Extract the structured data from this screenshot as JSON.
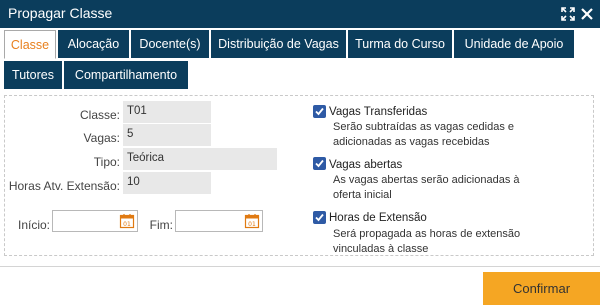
{
  "window": {
    "title": "Propagar Classe"
  },
  "tabs": [
    {
      "label": "Classe"
    },
    {
      "label": "Alocação"
    },
    {
      "label": "Docente(s)"
    },
    {
      "label": "Distribuição de Vagas"
    },
    {
      "label": "Turma do Curso"
    },
    {
      "label": "Unidade de Apoio"
    },
    {
      "label": "Tutores"
    },
    {
      "label": "Compartilhamento"
    }
  ],
  "form": {
    "classe": {
      "label": "Classe:",
      "value": "T01"
    },
    "vagas": {
      "label": "Vagas:",
      "value": "5"
    },
    "tipo": {
      "label": "Tipo:",
      "value": "Teórica"
    },
    "horas": {
      "label": "Horas Atv. Extensão:",
      "value": "10"
    },
    "inicio": {
      "label": "Início:",
      "value": ""
    },
    "fim": {
      "label": "Fim:",
      "value": ""
    }
  },
  "options": [
    {
      "label": "Vagas Transferidas",
      "checked": true,
      "desc1": "Serão subtraídas as vagas cedidas e",
      "desc2": "adicionadas as vagas recebidas"
    },
    {
      "label": "Vagas abertas",
      "checked": true,
      "desc1": "As vagas abertas serão adicionadas à",
      "desc2": "oferta inicial"
    },
    {
      "label": "Horas de Extensão",
      "checked": true,
      "desc1": "Será propagada as horas de extensão",
      "desc2": "vinculadas à classe"
    }
  ],
  "footer": {
    "confirm_label": "Confirmar"
  },
  "colors": {
    "header": "#0b3d5c",
    "active_tab_text": "#e8801e",
    "checkbox": "#2e5aa5",
    "confirm": "#f5a623"
  }
}
